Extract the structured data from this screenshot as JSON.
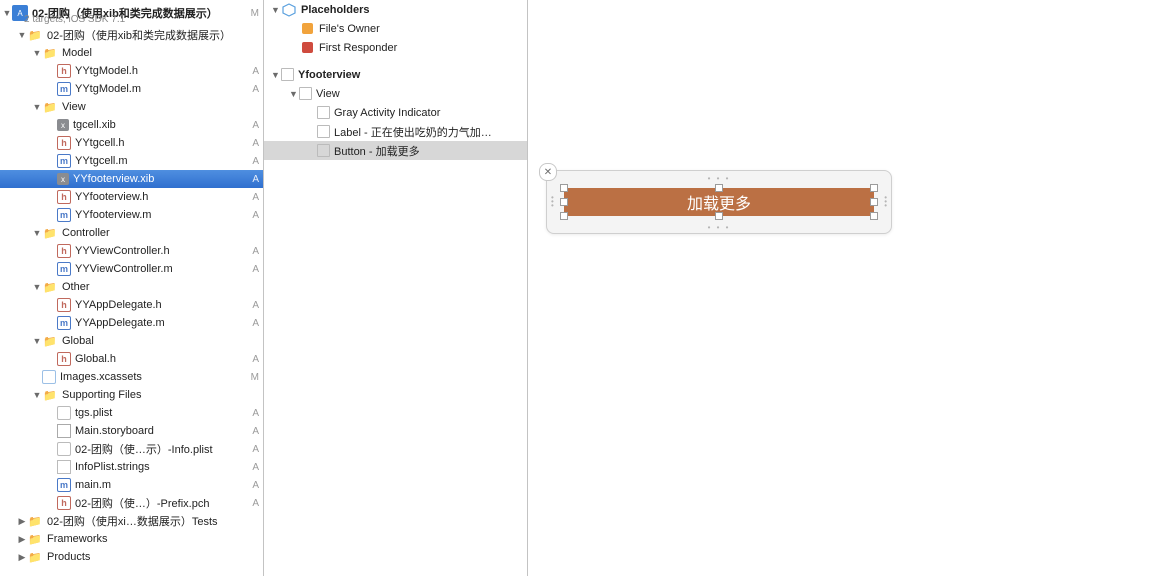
{
  "project": {
    "name": "02-团购（使用xib和类完成数据展示）",
    "subtitle": "2 targets, iOS SDK 7.1",
    "badge": "M"
  },
  "tree": [
    {
      "indent": 1,
      "tri": "down",
      "icon": "folder",
      "label": "02-团购（使用xib和类完成数据展示）",
      "badge": ""
    },
    {
      "indent": 2,
      "tri": "down",
      "icon": "folder",
      "label": "Model",
      "badge": ""
    },
    {
      "indent": 3,
      "icon": "h",
      "label": "YYtgModel.h",
      "badge": "A"
    },
    {
      "indent": 3,
      "icon": "m",
      "label": "YYtgModel.m",
      "badge": "A"
    },
    {
      "indent": 2,
      "tri": "down",
      "icon": "folder",
      "label": "View",
      "badge": ""
    },
    {
      "indent": 3,
      "icon": "xib",
      "label": "tgcell.xib",
      "badge": "A"
    },
    {
      "indent": 3,
      "icon": "h",
      "label": "YYtgcell.h",
      "badge": "A"
    },
    {
      "indent": 3,
      "icon": "m",
      "label": "YYtgcell.m",
      "badge": "A"
    },
    {
      "indent": 3,
      "icon": "xib",
      "label": "YYfooterview.xib",
      "badge": "A",
      "selected": true
    },
    {
      "indent": 3,
      "icon": "h",
      "label": "YYfooterview.h",
      "badge": "A"
    },
    {
      "indent": 3,
      "icon": "m",
      "label": "YYfooterview.m",
      "badge": "A"
    },
    {
      "indent": 2,
      "tri": "down",
      "icon": "folder",
      "label": "Controller",
      "badge": ""
    },
    {
      "indent": 3,
      "icon": "h",
      "label": "YYViewController.h",
      "badge": "A"
    },
    {
      "indent": 3,
      "icon": "m",
      "label": "YYViewController.m",
      "badge": "A"
    },
    {
      "indent": 2,
      "tri": "down",
      "icon": "folder",
      "label": "Other",
      "badge": ""
    },
    {
      "indent": 3,
      "icon": "h",
      "label": "YYAppDelegate.h",
      "badge": "A"
    },
    {
      "indent": 3,
      "icon": "m",
      "label": "YYAppDelegate.m",
      "badge": "A"
    },
    {
      "indent": 2,
      "tri": "down",
      "icon": "folder",
      "label": "Global",
      "badge": ""
    },
    {
      "indent": 3,
      "icon": "h",
      "label": "Global.h",
      "badge": "A"
    },
    {
      "indent": 2,
      "icon": "assets",
      "label": "Images.xcassets",
      "badge": "M"
    },
    {
      "indent": 2,
      "tri": "down",
      "icon": "folder",
      "label": "Supporting Files",
      "badge": ""
    },
    {
      "indent": 3,
      "icon": "plist",
      "label": "tgs.plist",
      "badge": "A"
    },
    {
      "indent": 3,
      "icon": "story",
      "label": "Main.storyboard",
      "badge": "A"
    },
    {
      "indent": 3,
      "icon": "plist",
      "label": "02-团购（使…示）-Info.plist",
      "badge": "A"
    },
    {
      "indent": 3,
      "icon": "txt",
      "label": "InfoPlist.strings",
      "badge": "A"
    },
    {
      "indent": 3,
      "icon": "m",
      "label": "main.m",
      "badge": "A"
    },
    {
      "indent": 3,
      "icon": "h",
      "label": "02-团购（使…）-Prefix.pch",
      "badge": "A"
    },
    {
      "indent": 1,
      "tri": "right",
      "icon": "folder",
      "label": "02-团购（使用xi…数据展示）Tests",
      "badge": ""
    },
    {
      "indent": 1,
      "tri": "right",
      "icon": "folder",
      "label": "Frameworks",
      "badge": ""
    },
    {
      "indent": 1,
      "tri": "right",
      "icon": "folder",
      "label": "Products",
      "badge": ""
    }
  ],
  "outline": [
    {
      "indent": 0,
      "tri": "down",
      "icon": "cube",
      "label": "Placeholders",
      "section": true
    },
    {
      "indent": 1,
      "icon": "owner",
      "label": "File's Owner"
    },
    {
      "indent": 1,
      "icon": "resp",
      "label": "First Responder"
    },
    {
      "blank": true
    },
    {
      "indent": 0,
      "tri": "down",
      "icon": "view",
      "label": "Yfooterview",
      "section": true
    },
    {
      "indent": 1,
      "tri": "down",
      "icon": "view",
      "label": "View"
    },
    {
      "indent": 2,
      "icon": "view",
      "label": "Gray Activity Indicator"
    },
    {
      "indent": 2,
      "icon": "view",
      "label": "Label - 正在使出吃奶的力气加…"
    },
    {
      "indent": 2,
      "icon": "view",
      "label": "Button - 加载更多",
      "selected": true
    }
  ],
  "canvas": {
    "button_title": "加载更多",
    "button_bg": "#bb7044",
    "button_fg": "#ffffff"
  }
}
